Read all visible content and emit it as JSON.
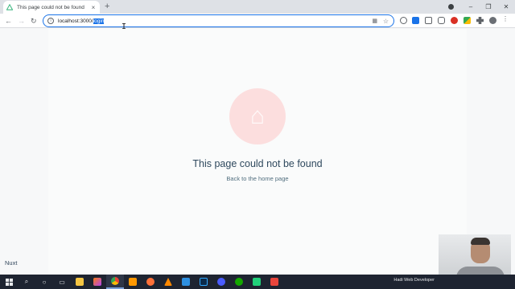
{
  "browser": {
    "tab_title": "This page could not be found",
    "tab_close": "×",
    "new_tab": "+",
    "window_controls": [
      "–",
      "❐",
      "✕"
    ],
    "url_host": "localhost:3000/",
    "url_path": "login",
    "back": "←",
    "forward": "→",
    "reload": "↻",
    "star": "☆"
  },
  "page": {
    "error_title": "This page could not be found",
    "home_link": "Back to the home page",
    "footer_label": "Nuxt"
  },
  "taskbar": {
    "user_label": "Hadi Web Developer",
    "apps": [
      "start",
      "search",
      "cortana",
      "task-view",
      "file-explorer",
      "jetbrains",
      "chrome",
      "sublime",
      "firefox",
      "vlc",
      "vscode",
      "photoshop",
      "app-c",
      "upwork",
      "camtasia",
      "app-red"
    ]
  },
  "colors": {
    "accent": "#1a73e8",
    "nuxt_green": "#3b8070",
    "error_text": "#2f495e",
    "taskbar": "#1e2431"
  }
}
